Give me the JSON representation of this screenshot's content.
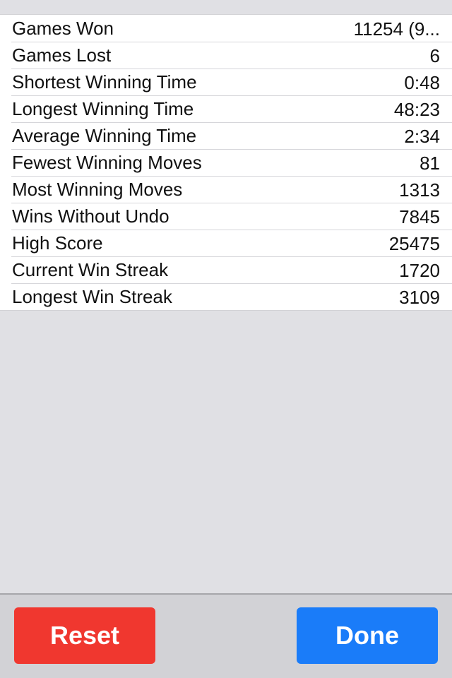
{
  "stats": [
    {
      "label": "Games Won",
      "value": "11254 (9..."
    },
    {
      "label": "Games Lost",
      "value": "6"
    },
    {
      "label": "Shortest Winning Time",
      "value": "0:48"
    },
    {
      "label": "Longest Winning Time",
      "value": "48:23"
    },
    {
      "label": "Average Winning Time",
      "value": "2:34"
    },
    {
      "label": "Fewest Winning Moves",
      "value": "81"
    },
    {
      "label": "Most Winning Moves",
      "value": "1313"
    },
    {
      "label": "Wins Without Undo",
      "value": "7845"
    },
    {
      "label": "High Score",
      "value": "25475"
    },
    {
      "label": "Current Win Streak",
      "value": "1720"
    },
    {
      "label": "Longest Win Streak",
      "value": "3109"
    }
  ],
  "toolbar": {
    "reset_label": "Reset",
    "done_label": "Done"
  },
  "colors": {
    "reset": "#f0372f",
    "done": "#1a7cf9",
    "background": "#e0e0e4"
  }
}
